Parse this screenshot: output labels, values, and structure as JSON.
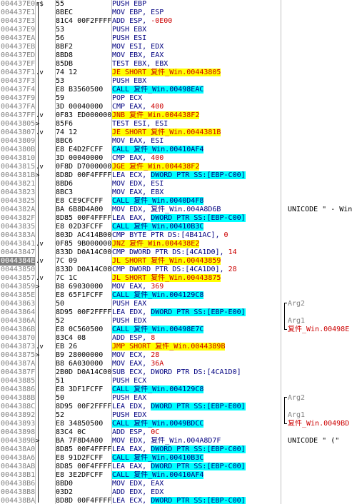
{
  "rows": [
    {
      "addr": "004437E0",
      "mark": "r$",
      "hex": "55",
      "parts": [
        {
          "t": "PUSH EBP",
          "c": "t-op"
        }
      ],
      "comment": ""
    },
    {
      "addr": "004437E1",
      "mark": "",
      "hex": "8BEC",
      "parts": [
        {
          "t": "MOV EBP, ESP",
          "c": "t-op"
        }
      ],
      "comment": ""
    },
    {
      "addr": "004437E3",
      "mark": "",
      "hex": "81C4 00F2FFFF",
      "parts": [
        {
          "t": "ADD ESP, ",
          "c": "t-op"
        },
        {
          "t": "-0E00",
          "c": "t-num"
        }
      ],
      "comment": ""
    },
    {
      "addr": "004437E9",
      "mark": "",
      "hex": "53",
      "parts": [
        {
          "t": "PUSH EBX",
          "c": "t-op"
        }
      ],
      "comment": ""
    },
    {
      "addr": "004437EA",
      "mark": "",
      "hex": "56",
      "parts": [
        {
          "t": "PUSH ESI",
          "c": "t-op"
        }
      ],
      "comment": ""
    },
    {
      "addr": "004437EB",
      "mark": "",
      "hex": "8BF2",
      "parts": [
        {
          "t": "MOV ESI, EDX",
          "c": "t-op"
        }
      ],
      "comment": ""
    },
    {
      "addr": "004437ED",
      "mark": "",
      "hex": "8BD8",
      "parts": [
        {
          "t": "MOV EBX, EAX",
          "c": "t-op"
        }
      ],
      "comment": ""
    },
    {
      "addr": "004437EF",
      "mark": "",
      "hex": "85DB",
      "parts": [
        {
          "t": "TEST EBX, EBX",
          "c": "t-op"
        }
      ],
      "comment": ""
    },
    {
      "addr": "004437F1",
      "mark": ".v",
      "hex": "74 12",
      "parts": [
        {
          "t": "JE SHORT 复件_Win.00443805",
          "c": "hl-yellow t-num"
        }
      ],
      "comment": ""
    },
    {
      "addr": "004437F3",
      "mark": "",
      "hex": "53",
      "parts": [
        {
          "t": "PUSH EBX",
          "c": "t-op"
        }
      ],
      "comment": ""
    },
    {
      "addr": "004437F4",
      "mark": "",
      "hex": "E8 B3560500",
      "parts": [
        {
          "t": "CALL 复件_Win.00498EAC",
          "c": "hl-cyan t-op"
        }
      ],
      "comment": ""
    },
    {
      "addr": "004437F9",
      "mark": "",
      "hex": "59",
      "parts": [
        {
          "t": "POP ECX",
          "c": "t-op"
        }
      ],
      "comment": ""
    },
    {
      "addr": "004437FA",
      "mark": "",
      "hex": "3D 00040000",
      "parts": [
        {
          "t": "CMP EAX, ",
          "c": "t-op"
        },
        {
          "t": "400",
          "c": "t-num"
        }
      ],
      "comment": ""
    },
    {
      "addr": "004437FF",
      "mark": ".v",
      "hex": "0F83 ED000000",
      "parts": [
        {
          "t": "JNB 复件_Win.004438F2",
          "c": "hl-yellow t-num"
        }
      ],
      "comment": ""
    },
    {
      "addr": "00443805",
      "mark": ">",
      "hex": "85F6",
      "parts": [
        {
          "t": "TEST ESI, ESI",
          "c": "t-op"
        }
      ],
      "comment": ""
    },
    {
      "addr": "00443807",
      "mark": ".v",
      "hex": "74 12",
      "parts": [
        {
          "t": "JE SHORT 复件_Win.0044381B",
          "c": "hl-yellow t-num"
        }
      ],
      "comment": ""
    },
    {
      "addr": "00443809",
      "mark": "",
      "hex": "8BC6",
      "parts": [
        {
          "t": "MOV EAX, ESI",
          "c": "t-op"
        }
      ],
      "comment": ""
    },
    {
      "addr": "0044380B",
      "mark": "",
      "hex": "E8 E4D2FCFF",
      "parts": [
        {
          "t": "CALL 复件_Win.00410AF4",
          "c": "hl-cyan t-op"
        }
      ],
      "comment": ""
    },
    {
      "addr": "00443810",
      "mark": "",
      "hex": "3D 00040000",
      "parts": [
        {
          "t": "CMP EAX, ",
          "c": "t-op"
        },
        {
          "t": "400",
          "c": "t-num"
        }
      ],
      "comment": ""
    },
    {
      "addr": "00443815",
      "mark": ".v",
      "hex": "0F8D D7000000",
      "parts": [
        {
          "t": "JGE 复件_Win.004438F2",
          "c": "hl-yellow t-num"
        }
      ],
      "comment": ""
    },
    {
      "addr": "0044381B",
      "mark": ">",
      "hex": "8D8D 00F4FFFF",
      "parts": [
        {
          "t": "LEA ECX, ",
          "c": "t-op"
        },
        {
          "t": "DWORD PTR SS:[EBP-C00]",
          "c": "hl-cyan t-mem"
        }
      ],
      "comment": ""
    },
    {
      "addr": "00443821",
      "mark": "",
      "hex": "8BD6",
      "parts": [
        {
          "t": "MOV EDX, ESI",
          "c": "t-op"
        }
      ],
      "comment": ""
    },
    {
      "addr": "00443823",
      "mark": "",
      "hex": "8BC3",
      "parts": [
        {
          "t": "MOV EAX, EBX",
          "c": "t-op"
        }
      ],
      "comment": ""
    },
    {
      "addr": "00443825",
      "mark": "",
      "hex": "E8 CE9CFCFF",
      "parts": [
        {
          "t": "CALL 复件_Win.0040D4F8",
          "c": "hl-cyan t-op"
        }
      ],
      "comment": ""
    },
    {
      "addr": "0044382A",
      "mark": "",
      "hex": "BA 6B8D4A00",
      "parts": [
        {
          "t": "MOV EDX, 复件_Win.004A8D6B",
          "c": "t-op"
        }
      ],
      "comment": "UNICODE \" - Win"
    },
    {
      "addr": "0044382F",
      "mark": "",
      "hex": "8D85 00F4FFFF",
      "parts": [
        {
          "t": "LEA EAX, ",
          "c": "t-op"
        },
        {
          "t": "DWORD PTR SS:[EBP-C00]",
          "c": "hl-cyan t-mem"
        }
      ],
      "comment": ""
    },
    {
      "addr": "00443835",
      "mark": "",
      "hex": "E8 02D3FCFF",
      "parts": [
        {
          "t": "CALL 复件_Win.00410B3C",
          "c": "hl-cyan t-op"
        }
      ],
      "comment": ""
    },
    {
      "addr": "0044383A",
      "mark": "",
      "hex": "803D AC414B00",
      "parts": [
        {
          "t": "CMP BYTE PTR DS:[4B41AC], ",
          "c": "t-op"
        },
        {
          "t": "0",
          "c": "t-num"
        }
      ],
      "comment": ""
    },
    {
      "addr": "00443841",
      "mark": ".v",
      "hex": "0F85 9B000000",
      "parts": [
        {
          "t": "JNZ 复件_Win.004438E2",
          "c": "hl-yellow t-num"
        }
      ],
      "comment": ""
    },
    {
      "addr": "00443847",
      "mark": "",
      "hex": "833D D0A14C00",
      "parts": [
        {
          "t": "CMP DWORD PTR DS:[4CA1D0], ",
          "c": "t-op"
        },
        {
          "t": "14",
          "c": "t-num"
        }
      ],
      "comment": ""
    },
    {
      "addr": "0044384E",
      "mark": ".v",
      "hex": "7C 09",
      "parts": [
        {
          "t": "JL SHORT 复件_Win.00443859",
          "c": "hl-yellow t-num"
        }
      ],
      "comment": "",
      "sel": true
    },
    {
      "addr": "00443850",
      "mark": "",
      "hex": "833D D0A14C00",
      "parts": [
        {
          "t": "CMP DWORD PTR DS:[4CA1D0], ",
          "c": "t-op"
        },
        {
          "t": "28",
          "c": "t-num"
        }
      ],
      "comment": ""
    },
    {
      "addr": "00443857",
      "mark": ".v",
      "hex": "7C 1C",
      "parts": [
        {
          "t": "JL SHORT 复件_Win.00443875",
          "c": "hl-yellow t-num"
        }
      ],
      "comment": ""
    },
    {
      "addr": "00443859",
      "mark": ">",
      "hex": "B8 69030000",
      "parts": [
        {
          "t": "MOV EAX, ",
          "c": "t-op"
        },
        {
          "t": "369",
          "c": "t-num"
        }
      ],
      "comment": ""
    },
    {
      "addr": "0044385E",
      "mark": "",
      "hex": "E8 65F1FCFF",
      "parts": [
        {
          "t": "CALL 复件_Win.004129C8",
          "c": "hl-cyan t-op"
        }
      ],
      "comment": ""
    },
    {
      "addr": "00443863",
      "mark": "",
      "hex": "50",
      "parts": [
        {
          "t": "PUSH EAX",
          "c": "t-op"
        }
      ],
      "comment": "Arg2",
      "ctype": "arg"
    },
    {
      "addr": "00443864",
      "mark": "",
      "hex": "8D95 00F2FFFF",
      "parts": [
        {
          "t": "LEA EDX, ",
          "c": "t-op"
        },
        {
          "t": "DWORD PTR SS:[EBP-E00]",
          "c": "hl-cyan t-mem"
        }
      ],
      "comment": ""
    },
    {
      "addr": "0044386A",
      "mark": "",
      "hex": "52",
      "parts": [
        {
          "t": "PUSH EDX",
          "c": "t-op"
        }
      ],
      "comment": "Arg1",
      "ctype": "arg"
    },
    {
      "addr": "0044386B",
      "mark": "",
      "hex": "E8 0C560500",
      "parts": [
        {
          "t": "CALL 复件_Win.00498E7C",
          "c": "hl-cyan t-op"
        }
      ],
      "comment": "复件_Win.00498E",
      "ctype": "call"
    },
    {
      "addr": "00443870",
      "mark": "",
      "hex": "83C4 08",
      "parts": [
        {
          "t": "ADD ESP, ",
          "c": "t-op"
        },
        {
          "t": "8",
          "c": "t-num"
        }
      ],
      "comment": ""
    },
    {
      "addr": "00443873",
      "mark": ".v",
      "hex": "EB 26",
      "parts": [
        {
          "t": "JMP SHORT 复件_Win.0044389B",
          "c": "hl-yellow t-num"
        }
      ],
      "comment": ""
    },
    {
      "addr": "00443875",
      "mark": ">",
      "hex": "B9 28000000",
      "parts": [
        {
          "t": "MOV ECX, ",
          "c": "t-op"
        },
        {
          "t": "28",
          "c": "t-num"
        }
      ],
      "comment": ""
    },
    {
      "addr": "0044387A",
      "mark": "",
      "hex": "B8 6A030000",
      "parts": [
        {
          "t": "MOV EAX, ",
          "c": "t-op"
        },
        {
          "t": "36A",
          "c": "t-num"
        }
      ],
      "comment": ""
    },
    {
      "addr": "0044387F",
      "mark": "",
      "hex": "2B0D D0A14C00",
      "parts": [
        {
          "t": "SUB ECX, DWORD PTR DS:[4CA1D0]",
          "c": "t-op"
        }
      ],
      "comment": ""
    },
    {
      "addr": "00443885",
      "mark": "",
      "hex": "51",
      "parts": [
        {
          "t": "PUSH ECX",
          "c": "t-op"
        }
      ],
      "comment": ""
    },
    {
      "addr": "00443886",
      "mark": "",
      "hex": "E8 3DF1FCFF",
      "parts": [
        {
          "t": "CALL 复件_Win.004129C8",
          "c": "hl-cyan t-op"
        }
      ],
      "comment": ""
    },
    {
      "addr": "0044388B",
      "mark": "",
      "hex": "50",
      "parts": [
        {
          "t": "PUSH EAX",
          "c": "t-op"
        }
      ],
      "comment": "Arg2",
      "ctype": "arg"
    },
    {
      "addr": "0044388C",
      "mark": "",
      "hex": "8D95 00F2FFFF",
      "parts": [
        {
          "t": "LEA EDX, ",
          "c": "t-op"
        },
        {
          "t": "DWORD PTR SS:[EBP-E00]",
          "c": "hl-cyan t-mem"
        }
      ],
      "comment": ""
    },
    {
      "addr": "00443892",
      "mark": "",
      "hex": "52",
      "parts": [
        {
          "t": "PUSH EDX",
          "c": "t-op"
        }
      ],
      "comment": "Arg1",
      "ctype": "arg"
    },
    {
      "addr": "00443893",
      "mark": "",
      "hex": "E8 34850500",
      "parts": [
        {
          "t": "CALL 复件_Win.0049BDCC",
          "c": "hl-cyan t-op"
        }
      ],
      "comment": "复件_Win.0049BD",
      "ctype": "call"
    },
    {
      "addr": "00443898",
      "mark": "",
      "hex": "83C4 0C",
      "parts": [
        {
          "t": "ADD ESP, ",
          "c": "t-op"
        },
        {
          "t": "0C",
          "c": "t-num"
        }
      ],
      "comment": ""
    },
    {
      "addr": "0044389B",
      "mark": ">",
      "hex": "BA 7F8D4A00",
      "parts": [
        {
          "t": "MOV EDX, 复件_Win.004A8D7F",
          "c": "t-op"
        }
      ],
      "comment": "UNICODE \" (\""
    },
    {
      "addr": "004438A0",
      "mark": "",
      "hex": "8D85 00F4FFFF",
      "parts": [
        {
          "t": "LEA EAX, ",
          "c": "t-op"
        },
        {
          "t": "DWORD PTR SS:[EBP-C00]",
          "c": "hl-cyan t-mem"
        }
      ],
      "comment": ""
    },
    {
      "addr": "004438A6",
      "mark": "",
      "hex": "E8 91D2FCFF",
      "parts": [
        {
          "t": "CALL 复件_Win.00410B3C",
          "c": "hl-cyan t-op"
        }
      ],
      "comment": ""
    },
    {
      "addr": "004438AB",
      "mark": "",
      "hex": "8D85 00F4FFFF",
      "parts": [
        {
          "t": "LEA EAX, ",
          "c": "t-op"
        },
        {
          "t": "DWORD PTR SS:[EBP-C00]",
          "c": "hl-cyan t-mem"
        }
      ],
      "comment": ""
    },
    {
      "addr": "004438B1",
      "mark": "",
      "hex": "E8 3E2DFCFF",
      "parts": [
        {
          "t": "CALL 复件_Win.00410AF4",
          "c": "hl-cyan t-op"
        }
      ],
      "comment": ""
    },
    {
      "addr": "004438B6",
      "mark": "",
      "hex": "8BD0",
      "parts": [
        {
          "t": "MOV EDX, EAX",
          "c": "t-op"
        }
      ],
      "comment": ""
    },
    {
      "addr": "004438B8",
      "mark": "",
      "hex": "03D2",
      "parts": [
        {
          "t": "ADD EDX, EDX",
          "c": "t-op"
        }
      ],
      "comment": ""
    },
    {
      "addr": "004438BA",
      "mark": "",
      "hex": "8D8D 00F4FFFF",
      "parts": [
        {
          "t": "LEA ECX, ",
          "c": "t-op"
        },
        {
          "t": "DWORD PTR SS:[EBP-C00]",
          "c": "hl-cyan t-mem"
        }
      ],
      "comment": ""
    }
  ]
}
